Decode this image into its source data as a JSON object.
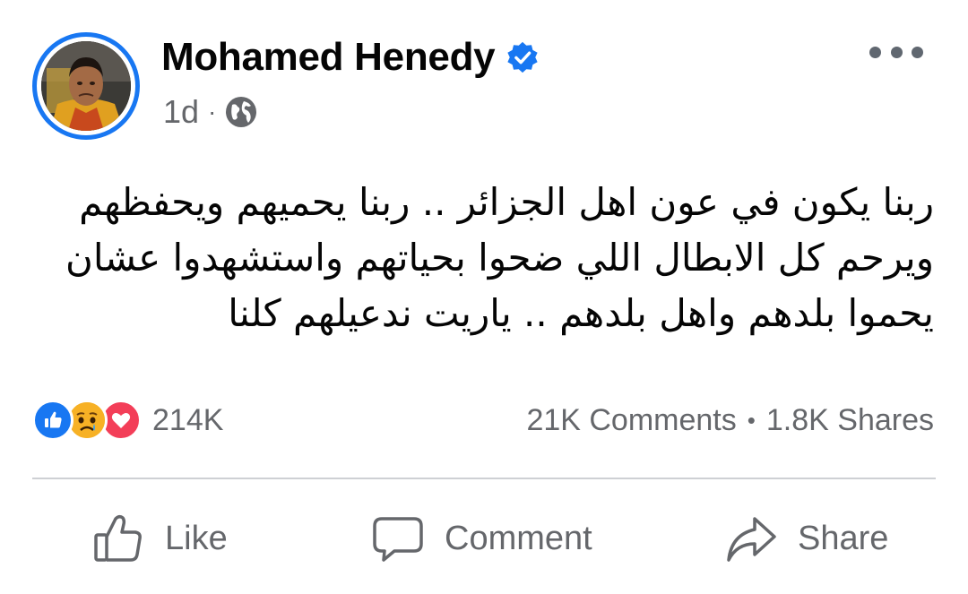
{
  "post": {
    "author": {
      "name": "Mohamed Henedy",
      "verified": true,
      "avatar_icon": "profile-photo"
    },
    "meta": {
      "time": "1d",
      "separator": "·",
      "audience_icon": "globe-icon"
    },
    "more_icon": "more-options-icon",
    "text_lines": [
      "ربنا يكون في عون اهل الجزائر .. ربنا يحميهم ويحفظهم",
      "ويرحم كل الابطال اللي ضحوا بحياتهم واستشهدوا عشان",
      "يحموا بلدهم واهل بلدهم  .. ياريت ندعيلهم كلنا"
    ],
    "reactions": {
      "types": [
        "like",
        "sad",
        "love"
      ],
      "count": "214K"
    },
    "stats": {
      "comments": "21K Comments",
      "separator": "•",
      "shares": "1.8K Shares"
    },
    "actions": {
      "like": "Like",
      "comment": "Comment",
      "share": "Share"
    }
  },
  "colors": {
    "accent": "#1877f2",
    "secondary_text": "#65676b",
    "love": "#f33e58",
    "sad": "#f7b125",
    "divider": "#ced0d4"
  }
}
